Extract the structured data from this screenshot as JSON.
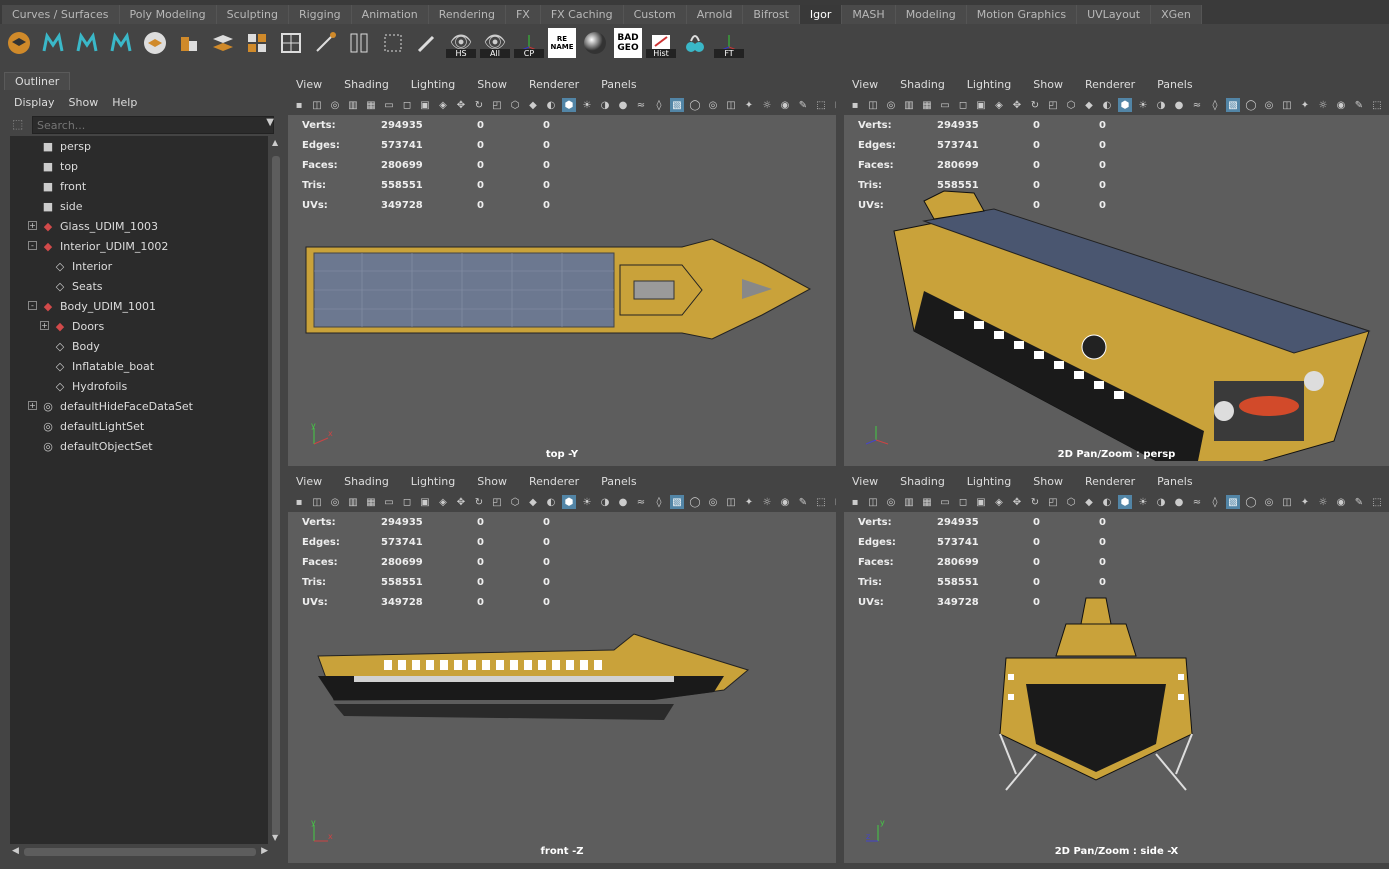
{
  "shelf": {
    "tabs": [
      "Curves / Surfaces",
      "Poly Modeling",
      "Sculpting",
      "Rigging",
      "Animation",
      "Rendering",
      "FX",
      "FX Caching",
      "Custom",
      "Arnold",
      "Bifrost",
      "Igor",
      "MASH",
      "Modeling",
      "Motion Graphics",
      "UVLayout",
      "XGen"
    ],
    "active_tab": "Igor",
    "icon_labels": {
      "hs": "HS",
      "all": "All",
      "cp": "CP",
      "rename": "RE NAME",
      "badgeo": "BAD GEO",
      "hist": "Hist",
      "ft": "FT"
    }
  },
  "outliner": {
    "tab": "Outliner",
    "menu": [
      "Display",
      "Show",
      "Help"
    ],
    "search_placeholder": "Search...",
    "items": [
      {
        "label": "persp",
        "icon": "camera-icon"
      },
      {
        "label": "top",
        "icon": "camera-icon"
      },
      {
        "label": "front",
        "icon": "camera-icon"
      },
      {
        "label": "side",
        "icon": "camera-icon"
      },
      {
        "label": "Glass_UDIM_1003",
        "icon": "mesh-group-icon",
        "expander": "+"
      },
      {
        "label": "Interior_UDIM_1002",
        "icon": "mesh-group-icon",
        "expander": "-"
      },
      {
        "label": "Interior",
        "icon": "transform-icon"
      },
      {
        "label": "Seats",
        "icon": "transform-icon"
      },
      {
        "label": "Body_UDIM_1001",
        "icon": "mesh-group-icon",
        "expander": "-"
      },
      {
        "label": "Doors",
        "icon": "mesh-group-icon",
        "expander": "+"
      },
      {
        "label": "Body",
        "icon": "transform-icon"
      },
      {
        "label": "Inflatable_boat",
        "icon": "transform-icon"
      },
      {
        "label": "Hydrofoils",
        "icon": "transform-icon"
      },
      {
        "label": "defaultHideFaceDataSet",
        "icon": "set-icon",
        "expander": "+"
      },
      {
        "label": "defaultLightSet",
        "icon": "set-icon"
      },
      {
        "label": "defaultObjectSet",
        "icon": "set-icon"
      }
    ]
  },
  "viewport_menu": [
    "View",
    "Shading",
    "Lighting",
    "Show",
    "Renderer",
    "Panels"
  ],
  "hud": {
    "rows": [
      {
        "k": "Verts:",
        "v": "294935",
        "a": "0",
        "b": "0"
      },
      {
        "k": "Edges:",
        "v": "573741",
        "a": "0",
        "b": "0"
      },
      {
        "k": "Faces:",
        "v": "280699",
        "a": "0",
        "b": "0"
      },
      {
        "k": "Tris:",
        "v": "558551",
        "a": "0",
        "b": "0"
      },
      {
        "k": "UVs:",
        "v": "349728",
        "a": "0",
        "b": "0"
      }
    ]
  },
  "viewports": {
    "top": {
      "camera_label": "top -Y"
    },
    "persp": {
      "camera_label": "2D Pan/Zoom : persp"
    },
    "front": {
      "camera_label": "front -Z"
    },
    "side": {
      "camera_label": "2D Pan/Zoom : side -X"
    }
  },
  "colors": {
    "hull_yellow": "#c9a23a",
    "hull_black": "#1a1a1a",
    "panel_blue": "#5a6a85",
    "viewport_bg": "#5d5d5d",
    "accent": "#5285a6"
  }
}
